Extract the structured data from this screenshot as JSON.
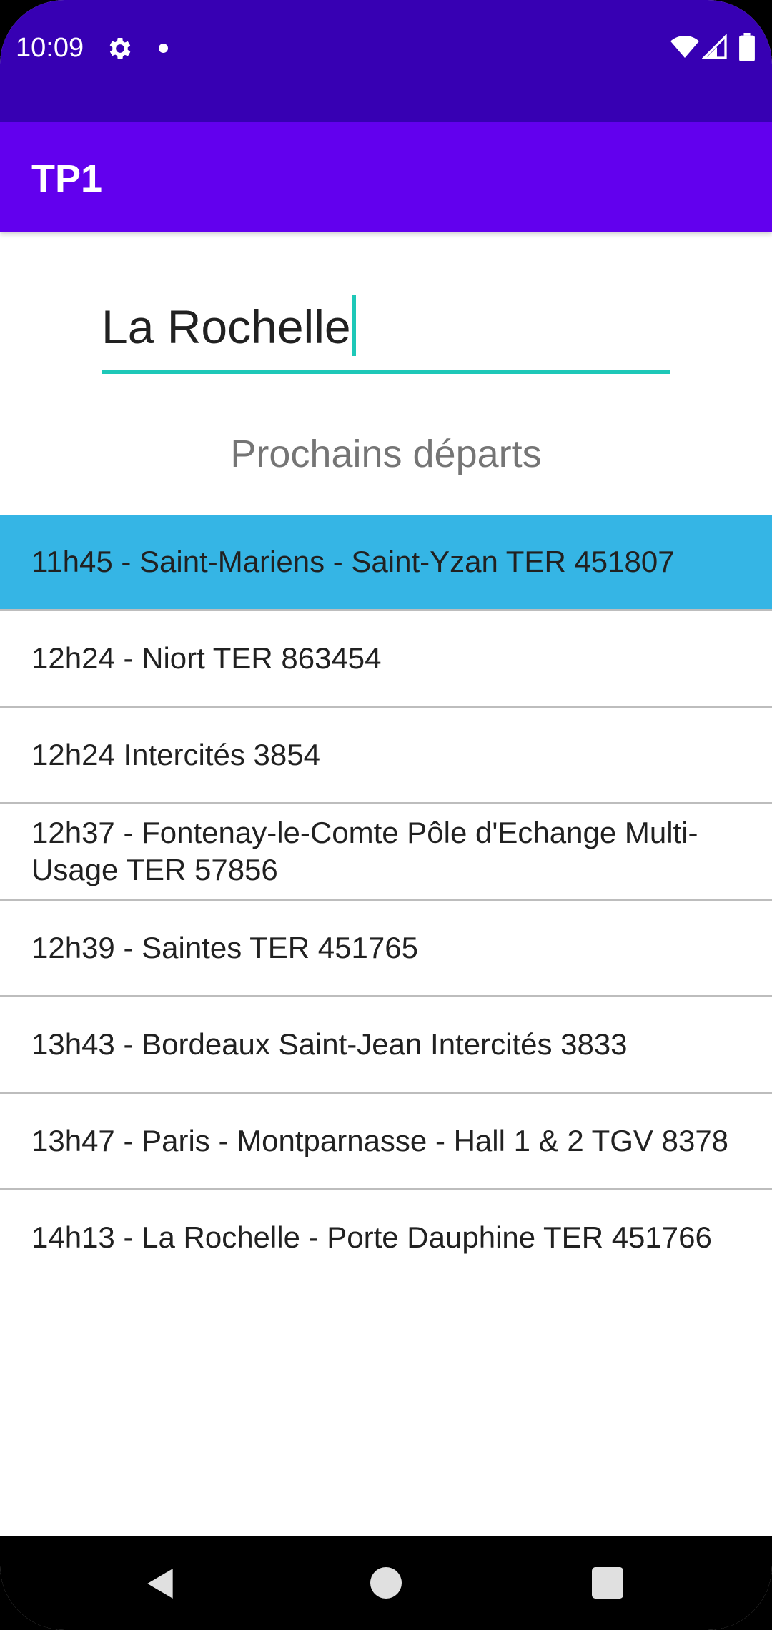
{
  "status_bar": {
    "time": "10:09",
    "icons": [
      "gear-icon",
      "dot-icon",
      "wifi-icon",
      "signal-icon",
      "battery-icon"
    ]
  },
  "app_bar": {
    "title": "TP1"
  },
  "search": {
    "value": "La Rochelle"
  },
  "section_heading": "Prochains départs",
  "departures": [
    {
      "label": "11h45 - Saint-Mariens - Saint-Yzan TER 451807",
      "selected": true
    },
    {
      "label": "12h24 - Niort TER 863454",
      "selected": false
    },
    {
      "label": "12h24 Intercités 3854",
      "selected": false
    },
    {
      "label": "12h37 - Fontenay-le-Comte Pôle d'Echange Multi-Usage TER 57856",
      "selected": false
    },
    {
      "label": "12h39 - Saintes TER 451765",
      "selected": false
    },
    {
      "label": "13h43 - Bordeaux Saint-Jean Intercités 3833",
      "selected": false
    },
    {
      "label": "13h47 - Paris - Montparnasse - Hall 1 & 2 TGV 8378",
      "selected": false
    },
    {
      "label": "14h13 - La Rochelle - Porte Dauphine TER 451766",
      "selected": false
    }
  ],
  "navigation": {
    "icons": [
      "back-icon",
      "home-icon",
      "recents-icon"
    ]
  },
  "colors": {
    "status_bar": "#3700b3",
    "app_bar": "#6200ee",
    "accent": "#1ec8b8",
    "selected_row": "#35b5e5",
    "divider": "#bdbdbd"
  }
}
